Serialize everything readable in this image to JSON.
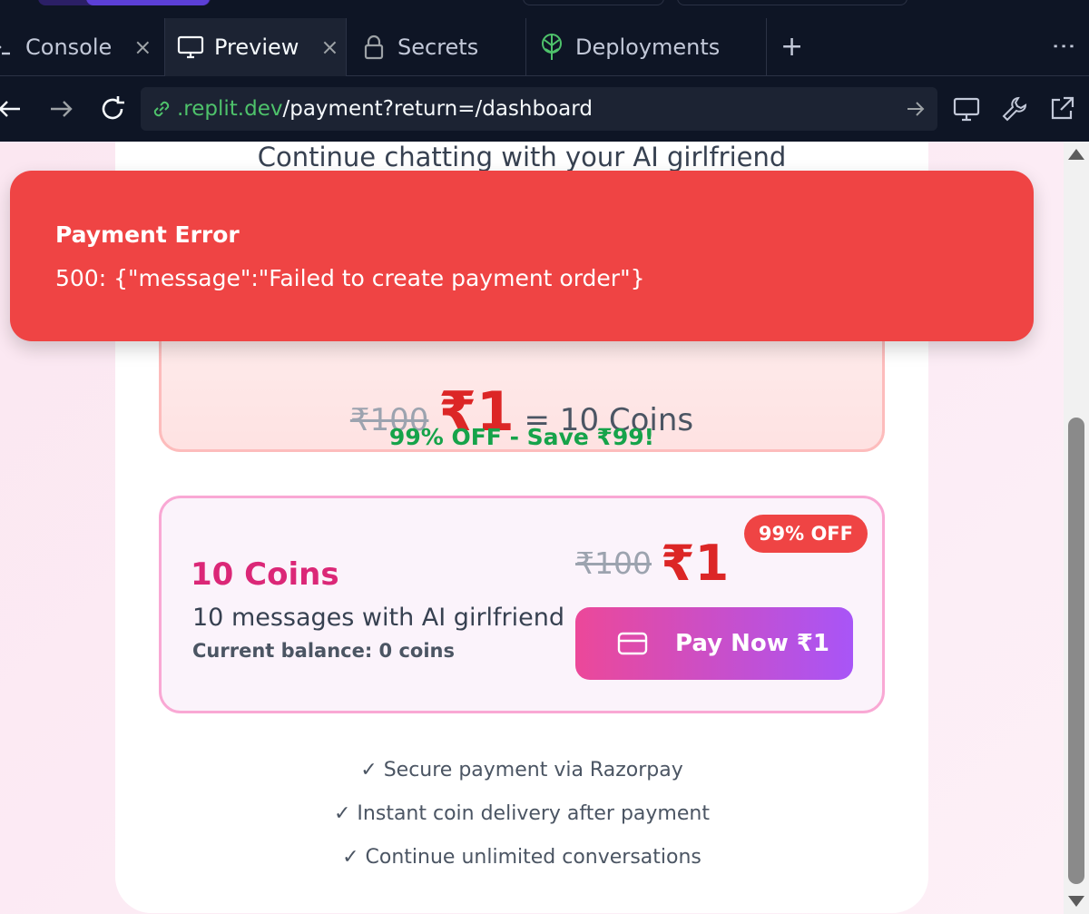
{
  "tabs": [
    {
      "label": "Console",
      "icon": "terminal-icon",
      "active": false
    },
    {
      "label": "Preview",
      "icon": "monitor-icon",
      "active": true
    },
    {
      "label": "Secrets",
      "icon": "lock-icon",
      "active": false
    },
    {
      "label": "Deployments",
      "icon": "deployments-icon",
      "active": false
    }
  ],
  "tab_close_glyph": "×",
  "tab_add_glyph": "+",
  "tab_more_glyph": "⋮",
  "address": {
    "host": ".replit.dev",
    "path": "/payment?return=/dashboard"
  },
  "page": {
    "subtitle": "Continue chatting with your AI girlfriend",
    "offer": {
      "old_price": "₹100",
      "new_price": "₹1",
      "equals": "= 10 Coins",
      "savings": "99% OFF - Save ₹99!"
    },
    "package": {
      "title": "10 Coins",
      "description": "10 messages with AI girlfriend",
      "balance": "Current balance: 0 coins",
      "badge": "99% OFF",
      "old_price": "₹100",
      "new_price": "₹1",
      "button_label": "Pay Now ₹1"
    },
    "features": [
      "✓ Secure payment via Razorpay",
      "✓ Instant coin delivery after payment",
      "✓ Continue unlimited conversations"
    ]
  },
  "toast": {
    "title": "Payment Error",
    "message": "500: {\"message\":\"Failed to create payment order\"}"
  },
  "colors": {
    "toast_bg": "#ef4444",
    "accent_pink": "#ec4899",
    "accent_purple": "#a855f7",
    "price_red": "#dc2626",
    "savings_green": "#16a34a",
    "url_host_green": "#4ec26b"
  }
}
